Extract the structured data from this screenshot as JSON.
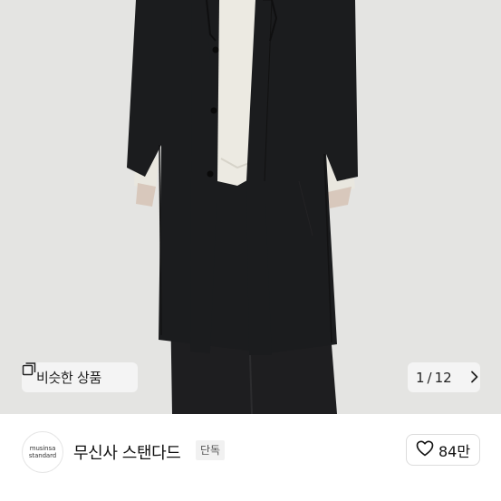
{
  "gallery": {
    "similar_button_label": "비슷한 상품",
    "current_index": "1",
    "separator": "/",
    "total": "12"
  },
  "brand": {
    "logo_line1": "musinsa",
    "logo_line2": "standard",
    "name": "무신사 스탠다드",
    "badge": "단독",
    "like_count": "84만"
  },
  "colors": {
    "hero_bg": "#e4e4e2",
    "coat": "#1b1c1e",
    "sweater": "#eceae2"
  },
  "icons": [
    "similar-items-icon",
    "chevron-right-icon",
    "heart-icon"
  ]
}
